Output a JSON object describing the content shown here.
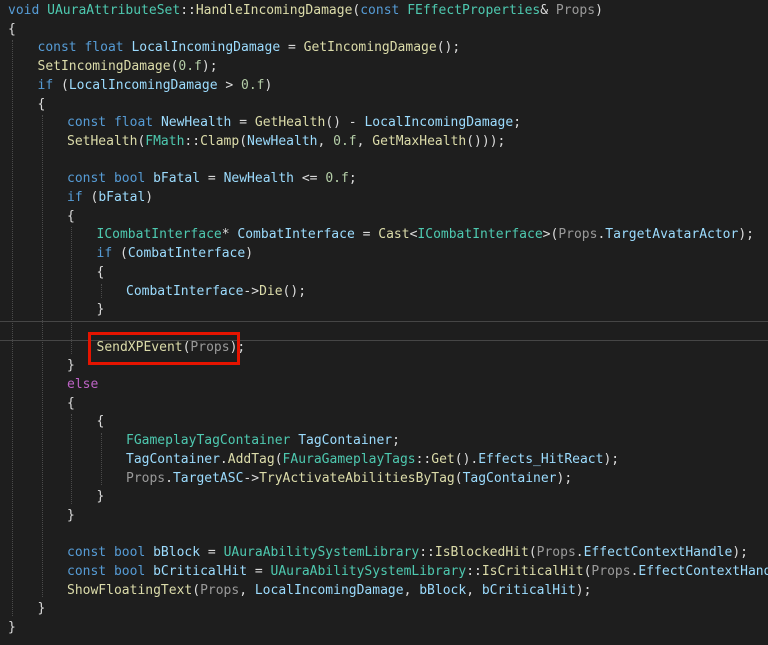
{
  "editor": {
    "language": "cpp",
    "lines": [
      {
        "indent": 0,
        "tokens": [
          [
            "kw",
            "void"
          ],
          [
            "pl",
            " "
          ],
          [
            "ty",
            "UAuraAttributeSet"
          ],
          [
            "pl",
            "::"
          ],
          [
            "fn",
            "HandleIncomingDamage"
          ],
          [
            "pl",
            "("
          ],
          [
            "kw",
            "const"
          ],
          [
            "pl",
            " "
          ],
          [
            "ty",
            "FEffectProperties"
          ],
          [
            "pl",
            "& "
          ],
          [
            "pm",
            "Props"
          ],
          [
            "pl",
            ")"
          ]
        ]
      },
      {
        "indent": 0,
        "tokens": [
          [
            "pl",
            "{"
          ]
        ]
      },
      {
        "indent": 1,
        "tokens": [
          [
            "kw",
            "const"
          ],
          [
            "pl",
            " "
          ],
          [
            "kw",
            "float"
          ],
          [
            "pl",
            " "
          ],
          [
            "vr",
            "LocalIncomingDamage"
          ],
          [
            "pl",
            " = "
          ],
          [
            "fn",
            "GetIncomingDamage"
          ],
          [
            "pl",
            "();"
          ]
        ]
      },
      {
        "indent": 1,
        "tokens": [
          [
            "fn",
            "SetIncomingDamage"
          ],
          [
            "pl",
            "("
          ],
          [
            "nm",
            "0.f"
          ],
          [
            "pl",
            ");"
          ]
        ]
      },
      {
        "indent": 1,
        "tokens": [
          [
            "kw",
            "if"
          ],
          [
            "pl",
            " ("
          ],
          [
            "vr",
            "LocalIncomingDamage"
          ],
          [
            "pl",
            " > "
          ],
          [
            "nm",
            "0.f"
          ],
          [
            "pl",
            ")"
          ]
        ]
      },
      {
        "indent": 1,
        "tokens": [
          [
            "pl",
            "{"
          ]
        ]
      },
      {
        "indent": 2,
        "tokens": [
          [
            "kw",
            "const"
          ],
          [
            "pl",
            " "
          ],
          [
            "kw",
            "float"
          ],
          [
            "pl",
            " "
          ],
          [
            "vr",
            "NewHealth"
          ],
          [
            "pl",
            " = "
          ],
          [
            "fn",
            "GetHealth"
          ],
          [
            "pl",
            "() - "
          ],
          [
            "vr",
            "LocalIncomingDamage"
          ],
          [
            "pl",
            ";"
          ]
        ]
      },
      {
        "indent": 2,
        "tokens": [
          [
            "fn",
            "SetHealth"
          ],
          [
            "pl",
            "("
          ],
          [
            "ty",
            "FMath"
          ],
          [
            "pl",
            "::"
          ],
          [
            "fn",
            "Clamp"
          ],
          [
            "pl",
            "("
          ],
          [
            "vr",
            "NewHealth"
          ],
          [
            "pl",
            ", "
          ],
          [
            "nm",
            "0.f"
          ],
          [
            "pl",
            ", "
          ],
          [
            "fn",
            "GetMaxHealth"
          ],
          [
            "pl",
            "()));"
          ]
        ]
      },
      {
        "indent": 0,
        "tokens": []
      },
      {
        "indent": 2,
        "tokens": [
          [
            "kw",
            "const"
          ],
          [
            "pl",
            " "
          ],
          [
            "kw",
            "bool"
          ],
          [
            "pl",
            " "
          ],
          [
            "vr",
            "bFatal"
          ],
          [
            "pl",
            " = "
          ],
          [
            "vr",
            "NewHealth"
          ],
          [
            "pl",
            " <= "
          ],
          [
            "nm",
            "0.f"
          ],
          [
            "pl",
            ";"
          ]
        ]
      },
      {
        "indent": 2,
        "tokens": [
          [
            "kw",
            "if"
          ],
          [
            "pl",
            " ("
          ],
          [
            "vr",
            "bFatal"
          ],
          [
            "pl",
            ")"
          ]
        ]
      },
      {
        "indent": 2,
        "tokens": [
          [
            "pl",
            "{"
          ]
        ]
      },
      {
        "indent": 3,
        "tokens": [
          [
            "ty",
            "ICombatInterface"
          ],
          [
            "pl",
            "* "
          ],
          [
            "vr",
            "CombatInterface"
          ],
          [
            "pl",
            " = "
          ],
          [
            "fn",
            "Cast"
          ],
          [
            "pl",
            "<"
          ],
          [
            "ty",
            "ICombatInterface"
          ],
          [
            "pl",
            ">("
          ],
          [
            "pm",
            "Props"
          ],
          [
            "pl",
            "."
          ],
          [
            "vr",
            "TargetAvatarActor"
          ],
          [
            "pl",
            ");"
          ]
        ]
      },
      {
        "indent": 3,
        "tokens": [
          [
            "kw",
            "if"
          ],
          [
            "pl",
            " ("
          ],
          [
            "vr",
            "CombatInterface"
          ],
          [
            "pl",
            ")"
          ]
        ]
      },
      {
        "indent": 3,
        "tokens": [
          [
            "pl",
            "{"
          ]
        ]
      },
      {
        "indent": 4,
        "tokens": [
          [
            "vr",
            "CombatInterface"
          ],
          [
            "pl",
            "->"
          ],
          [
            "fn",
            "Die"
          ],
          [
            "pl",
            "();"
          ]
        ]
      },
      {
        "indent": 3,
        "tokens": [
          [
            "pl",
            "}"
          ]
        ]
      },
      {
        "indent": 0,
        "tokens": []
      },
      {
        "indent": 3,
        "tokens": [
          [
            "fn",
            "SendXPEvent"
          ],
          [
            "pl",
            "("
          ],
          [
            "pm",
            "Props"
          ],
          [
            "pl",
            ");"
          ]
        ]
      },
      {
        "indent": 2,
        "tokens": [
          [
            "pl",
            "}"
          ]
        ]
      },
      {
        "indent": 2,
        "tokens": [
          [
            "mc",
            "else"
          ]
        ]
      },
      {
        "indent": 2,
        "tokens": [
          [
            "pl",
            "{"
          ]
        ]
      },
      {
        "indent": 3,
        "tokens": [
          [
            "pl",
            "{"
          ]
        ]
      },
      {
        "indent": 4,
        "tokens": [
          [
            "ty",
            "FGameplayTagContainer"
          ],
          [
            "pl",
            " "
          ],
          [
            "vr",
            "TagContainer"
          ],
          [
            "pl",
            ";"
          ]
        ]
      },
      {
        "indent": 4,
        "tokens": [
          [
            "vr",
            "TagContainer"
          ],
          [
            "pl",
            "."
          ],
          [
            "fn",
            "AddTag"
          ],
          [
            "pl",
            "("
          ],
          [
            "ty",
            "FAuraGameplayTags"
          ],
          [
            "pl",
            "::"
          ],
          [
            "fn",
            "Get"
          ],
          [
            "pl",
            "()."
          ],
          [
            "vr",
            "Effects_HitReact"
          ],
          [
            "pl",
            ");"
          ]
        ]
      },
      {
        "indent": 4,
        "tokens": [
          [
            "pm",
            "Props"
          ],
          [
            "pl",
            "."
          ],
          [
            "vr",
            "TargetASC"
          ],
          [
            "pl",
            "->"
          ],
          [
            "fn",
            "TryActivateAbilitiesByTag"
          ],
          [
            "pl",
            "("
          ],
          [
            "vr",
            "TagContainer"
          ],
          [
            "pl",
            ");"
          ]
        ]
      },
      {
        "indent": 3,
        "tokens": [
          [
            "pl",
            "}"
          ]
        ]
      },
      {
        "indent": 2,
        "tokens": [
          [
            "pl",
            "}"
          ]
        ]
      },
      {
        "indent": 0,
        "tokens": []
      },
      {
        "indent": 2,
        "tokens": [
          [
            "kw",
            "const"
          ],
          [
            "pl",
            " "
          ],
          [
            "kw",
            "bool"
          ],
          [
            "pl",
            " "
          ],
          [
            "vr",
            "bBlock"
          ],
          [
            "pl",
            " = "
          ],
          [
            "ty",
            "UAuraAbilitySystemLibrary"
          ],
          [
            "pl",
            "::"
          ],
          [
            "fn",
            "IsBlockedHit"
          ],
          [
            "pl",
            "("
          ],
          [
            "pm",
            "Props"
          ],
          [
            "pl",
            "."
          ],
          [
            "vr",
            "EffectContextHandle"
          ],
          [
            "pl",
            ");"
          ]
        ]
      },
      {
        "indent": 2,
        "tokens": [
          [
            "kw",
            "const"
          ],
          [
            "pl",
            " "
          ],
          [
            "kw",
            "bool"
          ],
          [
            "pl",
            " "
          ],
          [
            "vr",
            "bCriticalHit"
          ],
          [
            "pl",
            " = "
          ],
          [
            "ty",
            "UAuraAbilitySystemLibrary"
          ],
          [
            "pl",
            "::"
          ],
          [
            "fn",
            "IsCriticalHit"
          ],
          [
            "pl",
            "("
          ],
          [
            "pm",
            "Props"
          ],
          [
            "pl",
            "."
          ],
          [
            "vr",
            "EffectContextHandle"
          ],
          [
            "pl",
            ");"
          ]
        ]
      },
      {
        "indent": 2,
        "tokens": [
          [
            "fn",
            "ShowFloatingText"
          ],
          [
            "pl",
            "("
          ],
          [
            "pm",
            "Props"
          ],
          [
            "pl",
            ", "
          ],
          [
            "vr",
            "LocalIncomingDamage"
          ],
          [
            "pl",
            ", "
          ],
          [
            "vr",
            "bBlock"
          ],
          [
            "pl",
            ", "
          ],
          [
            "vr",
            "bCriticalHit"
          ],
          [
            "pl",
            ");"
          ]
        ]
      },
      {
        "indent": 1,
        "tokens": [
          [
            "pl",
            "}"
          ]
        ]
      },
      {
        "indent": 0,
        "tokens": [
          [
            "pl",
            "}"
          ]
        ]
      }
    ],
    "highlighted_line": 18
  }
}
